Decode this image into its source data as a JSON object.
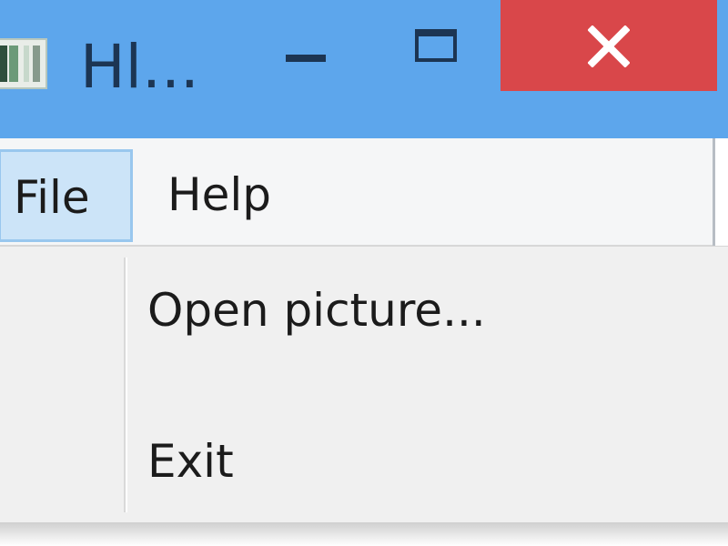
{
  "window": {
    "title": "Hl...",
    "titlebar_color": "#5da6ec",
    "close_color": "#d9474a",
    "icons": {
      "app": "app-icon",
      "minimize": "minimize-icon",
      "maximize": "maximize-icon",
      "close": "close-icon"
    }
  },
  "menubar": {
    "items": [
      {
        "label": "File",
        "state": "open"
      },
      {
        "label": "Help"
      }
    ]
  },
  "file_menu": {
    "items": [
      {
        "label": "Open picture..."
      },
      {
        "label": "Exit"
      }
    ]
  }
}
